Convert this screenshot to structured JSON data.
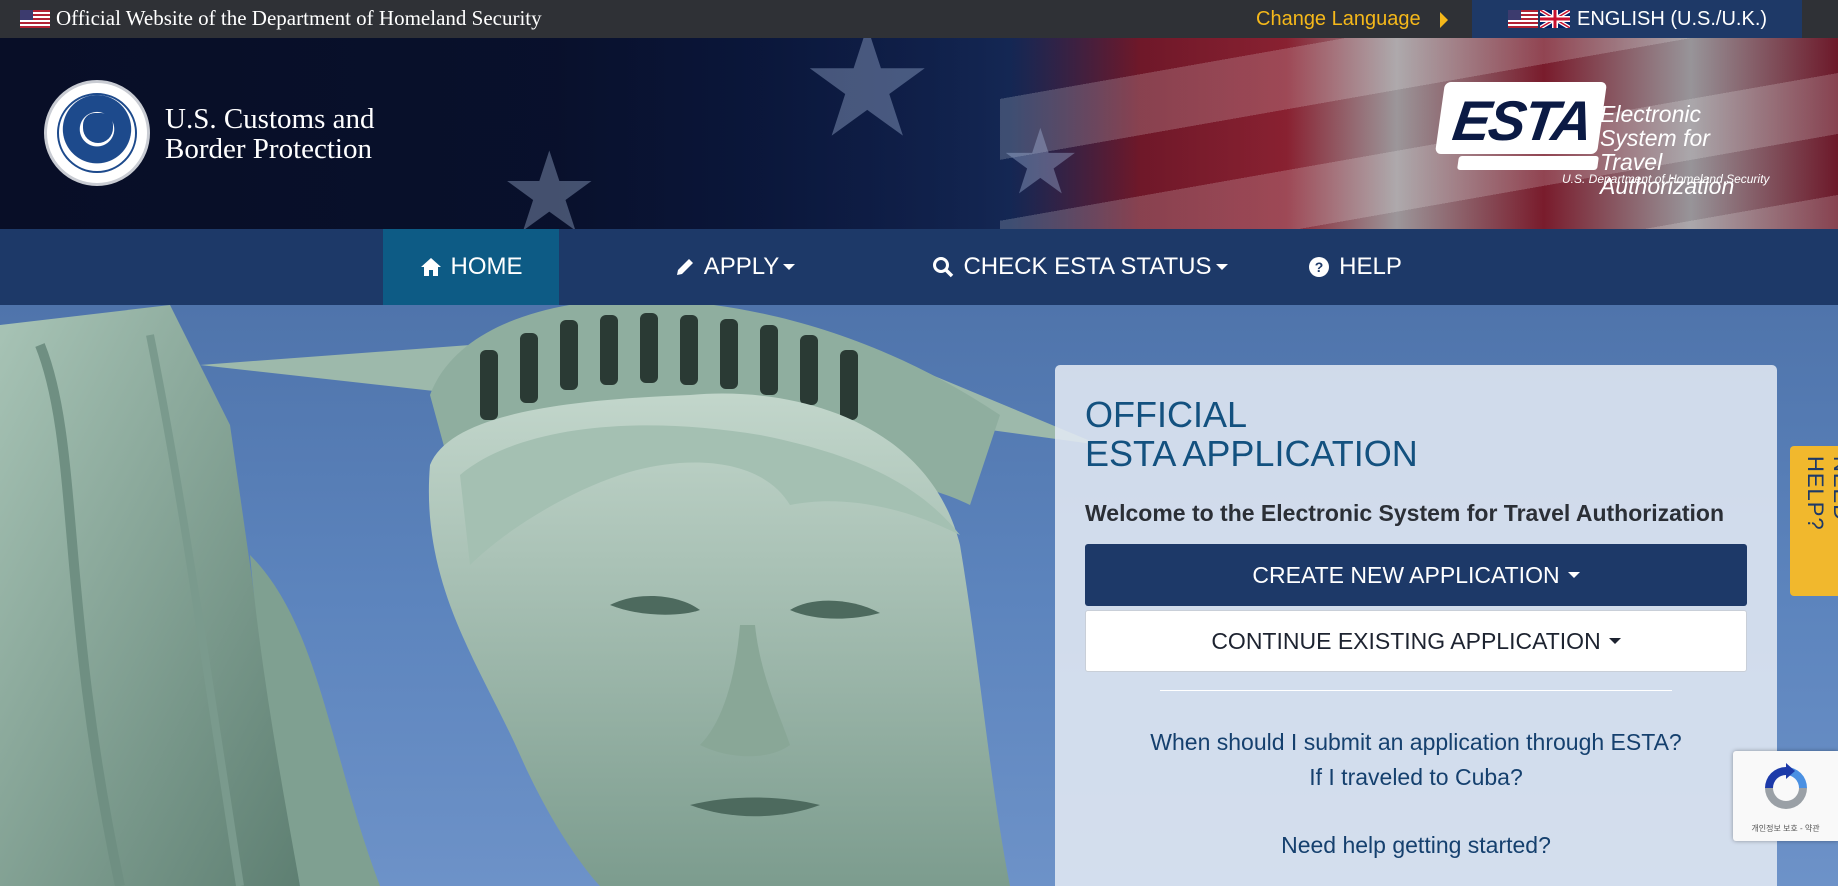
{
  "topbar": {
    "official_text": "Official Website of the Department of Homeland Security",
    "change_language": "Change Language",
    "current_language": "ENGLISH (U.S./U.K.)"
  },
  "header": {
    "agency_line1": "U.S. Customs and",
    "agency_line2": "Border Protection",
    "esta_logo_word": "ESTA",
    "esta_full_line1": "Electronic System for",
    "esta_full_line2": "Travel Authorization",
    "esta_dept": "U.S. Department of Homeland Security"
  },
  "nav": {
    "items": [
      {
        "label": "HOME",
        "icon": "home-icon",
        "active": true
      },
      {
        "label": "APPLY",
        "icon": "pencil-icon",
        "dropdown": true
      },
      {
        "label": "CHECK ESTA STATUS",
        "icon": "search-icon",
        "dropdown": true
      },
      {
        "label": "HELP",
        "icon": "question-circle-icon"
      }
    ]
  },
  "card": {
    "title_line1": "OFFICIAL",
    "title_line2": "ESTA APPLICATION",
    "welcome": "Welcome to the Electronic System for Travel Authorization",
    "create_label": "CREATE NEW APPLICATION",
    "continue_label": "CONTINUE EXISTING APPLICATION",
    "links": [
      "When should I submit an application through ESTA?",
      "If I traveled to Cuba?",
      "Need help getting started?"
    ]
  },
  "side_tab": {
    "label": "NEED HELP?"
  },
  "recaptcha": {
    "text": "개인정보 보호 - 약관"
  },
  "colors": {
    "nav_bg": "#1d3968",
    "nav_active": "#0d5b85",
    "accent_gold": "#f5b81a",
    "title_blue": "#13517f"
  }
}
